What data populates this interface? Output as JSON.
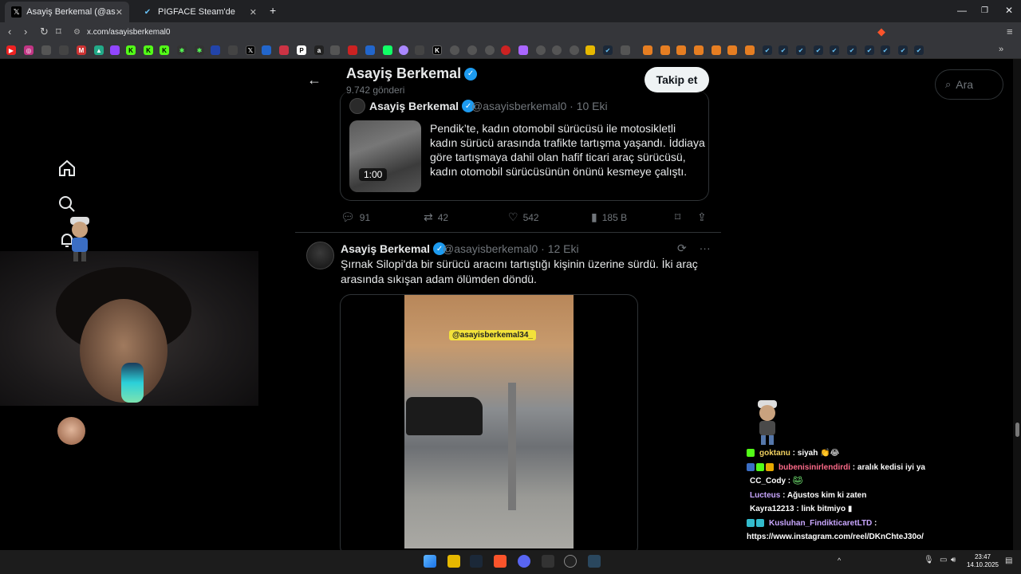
{
  "browser": {
    "tabs": [
      {
        "title": "Asayiş Berkemal (@asayisberkem",
        "icon": "x-logo-icon",
        "active": true
      },
      {
        "title": "PIGFACE Steam'de",
        "icon": "steam-icon",
        "active": false
      }
    ],
    "new_tab": "+",
    "url": "x.com/asayisberkemal0",
    "window_controls": {
      "minimize": "—",
      "restore": "❐",
      "close": "✕"
    }
  },
  "profile": {
    "back_icon": "arrow-left-icon",
    "name": "Asayiş Berkemal",
    "post_count": "9.742 gönderi",
    "follow_label": "Takip et"
  },
  "search": {
    "placeholder": "Ara"
  },
  "quoted_post": {
    "name": "Asayiş Berkemal",
    "handle": "@asayisberkemal0",
    "date": "10 Eki",
    "duration": "1:00",
    "text": "Pendik’te, kadın otomobil sürücüsü ile motosikletli kadın sürücü arasında trafikte tartışma yaşandı. İddiaya göre tartışmaya dahil olan hafif ticari araç sürücüsü, kadın otomobil sürücüsünün önünü kesmeye çalıştı."
  },
  "actions": {
    "replies": "91",
    "reposts": "42",
    "likes": "542",
    "views": "185 B"
  },
  "second_post": {
    "name": "Asayiş Berkemal",
    "handle": "@asayisberkemal0",
    "date": "12 Eki",
    "text": "Şırnak Silopi'da bir sürücü aracını tartıştığı kişinin üzerine sürdü. İki araç arasında sıkışan adam ölümden döndü.",
    "video_watermark": "@asayisberkemal34_"
  },
  "chat": [
    {
      "user": "goktanu",
      "message": "siyah",
      "color": "#f0d060"
    },
    {
      "user": "bubenisinirlendirdi",
      "message": "aralık kedisi iyi ya",
      "color": "#ff6b8a"
    },
    {
      "user": "CC_Cody",
      "message": "",
      "color": "#ffffff"
    },
    {
      "user": "Lucteus",
      "message": "Ağustos kim ki zaten",
      "color": "#c9a7ff"
    },
    {
      "user": "Kayra12213",
      "message": "link bitmiyo",
      "color": "#ffffff"
    },
    {
      "user": "Kusluhan_FindikticaretLTD",
      "message": "",
      "color": "#c9a7ff"
    },
    {
      "user": "",
      "message": "https://www.instagram.com/reel/DKnChteJ30o/",
      "color": "#ffffff"
    }
  ],
  "clock": {
    "time": "23:47",
    "date": "14.10.2025"
  }
}
